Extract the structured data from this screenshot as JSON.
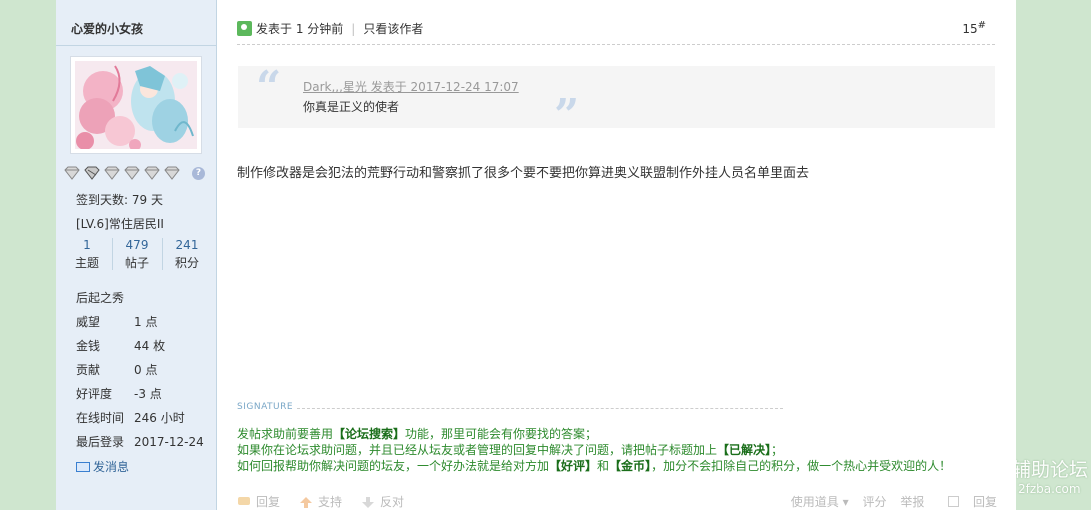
{
  "watermark": {
    "line1": "辅助论坛",
    "line2": "2fzba.com"
  },
  "author": {
    "name": "心爱的小女孩",
    "signin": "签到天数: 79 天",
    "level": "[LV.6]常住居民II",
    "stats": [
      {
        "num": "1",
        "label": "主题"
      },
      {
        "num": "479",
        "label": "帖子"
      },
      {
        "num": "241",
        "label": "积分"
      }
    ],
    "title_badge": "后起之秀",
    "info": [
      {
        "key": "威望",
        "value": "1 点"
      },
      {
        "key": "金钱",
        "value": "44 枚"
      },
      {
        "key": "贡献",
        "value": "0 点"
      },
      {
        "key": "好评度",
        "value": "-3 点"
      },
      {
        "key": "在线时间",
        "value": "246 小时"
      },
      {
        "key": "最后登录",
        "value": "2017-12-24"
      }
    ],
    "message_link": "发消息",
    "help_icon": "?"
  },
  "post": {
    "posted": "发表于 1 分钟前",
    "only_author": "只看该作者",
    "floor": "15",
    "floor_sup": "#",
    "quote": {
      "meta": "Dark,,,星光 发表于 2017-12-24 17:07",
      "text": "你真是正义的使者"
    },
    "body": "制作修改器是会犯法的荒野行动和警察抓了很多个要不要把你算进奥义联盟制作外挂人员名单里面去"
  },
  "signature": {
    "label": "SIGNATURE",
    "line1": "发帖求助前要善用【论坛搜索】功能，那里可能会有你要找的答案；",
    "line2": "如果你在论坛求助问题，并且已经从坛友或者管理的回复中解决了问题，请把帖子标题加上【已解决】；",
    "line3": "如何回报帮助你解决问题的坛友，一个好办法就是给对方加【好评】和【金币】，加分不会扣除自己的积分，做一个热心并受欢迎的人！"
  },
  "actions": {
    "reply": "回复",
    "support": "支持",
    "oppose": "反对",
    "use_props": "使用道具 ▾",
    "rate": "评分",
    "report": "举报",
    "tick": "回复"
  }
}
